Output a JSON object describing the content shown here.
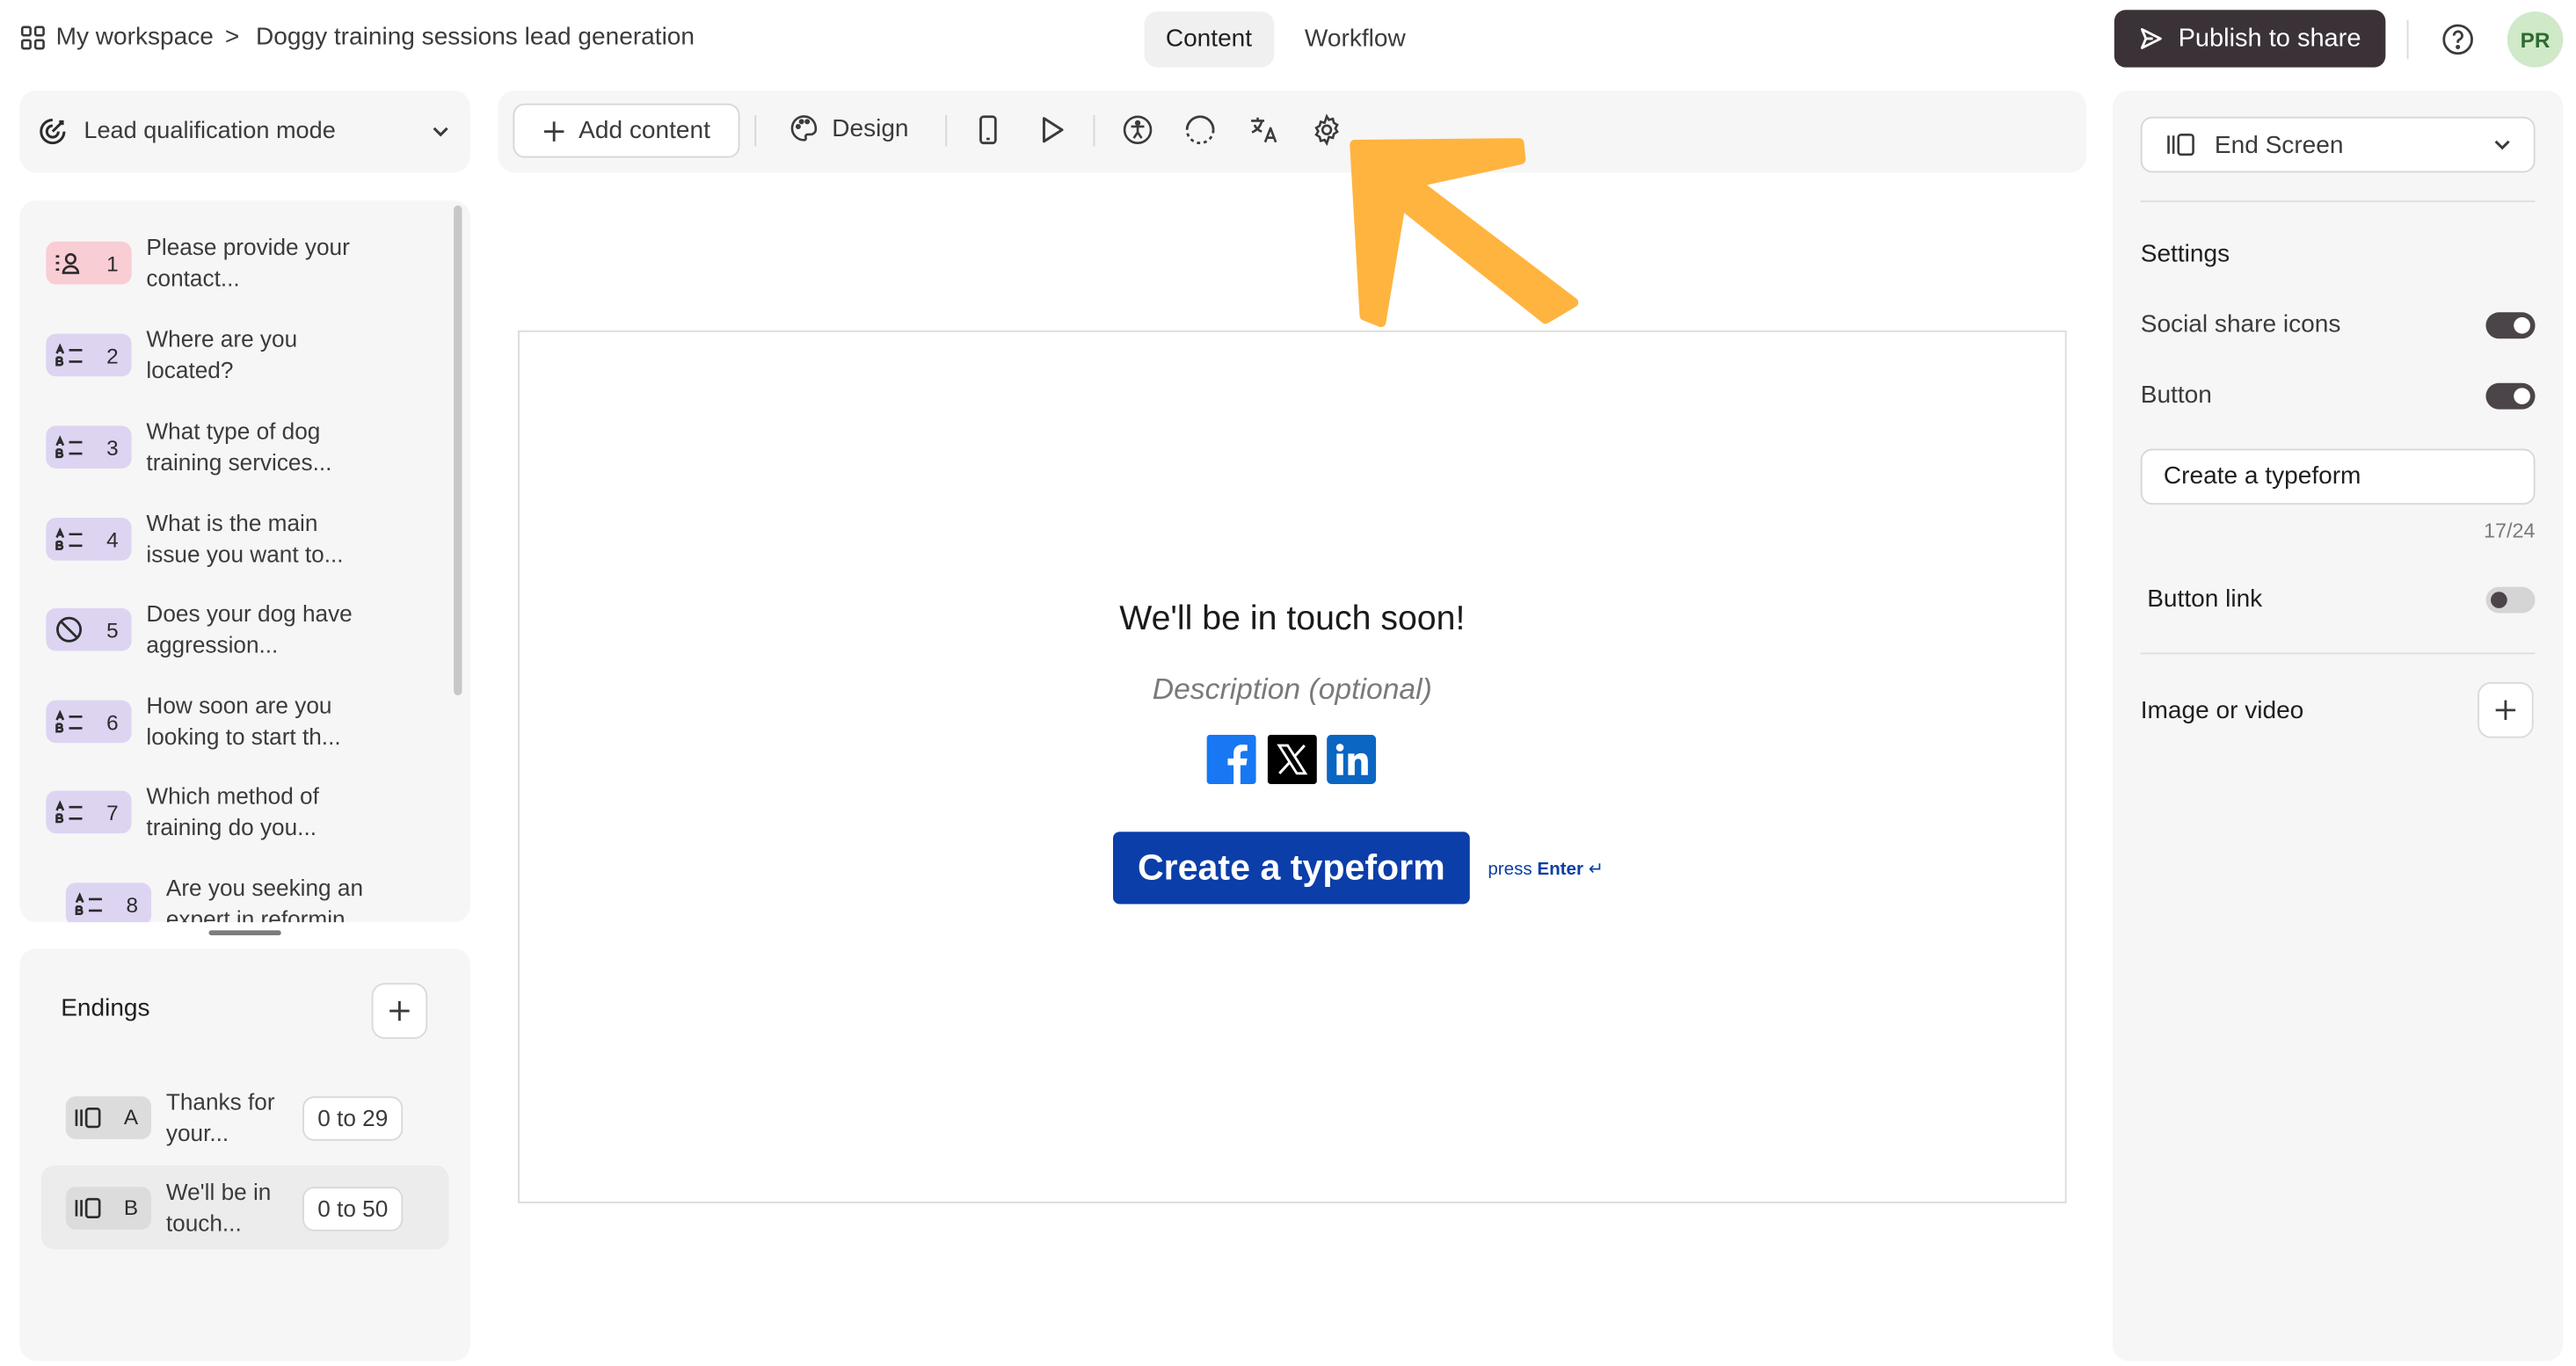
{
  "header": {
    "workspace": "My workspace",
    "separator": ">",
    "form_title": "Doggy training sessions lead generation",
    "tabs": [
      {
        "label": "Content",
        "active": true
      },
      {
        "label": "Workflow",
        "active": false
      }
    ],
    "publish_label": "Publish to share",
    "avatar_initials": "PR"
  },
  "sidebar": {
    "mode_label": "Lead qualification mode",
    "questions": [
      {
        "number": "1",
        "text": "Please provide your contact...",
        "icon": "contact-icon",
        "color": "#f8cdd3"
      },
      {
        "number": "2",
        "text": "Where are you located?",
        "icon": "multiple-choice-icon",
        "color": "#ddd4f2"
      },
      {
        "number": "3",
        "text": "What type of dog training services...",
        "icon": "multiple-choice-icon",
        "color": "#ddd4f2"
      },
      {
        "number": "4",
        "text": "What is the main issue you want to...",
        "icon": "multiple-choice-icon",
        "color": "#ddd4f2"
      },
      {
        "number": "5",
        "text": "Does your dog have aggression...",
        "icon": "yes-no-icon",
        "color": "#ddd4f2"
      },
      {
        "number": "6",
        "text": "How soon are you looking to start th...",
        "icon": "multiple-choice-icon",
        "color": "#ddd4f2"
      },
      {
        "number": "7",
        "text": "Which method of training do you...",
        "icon": "multiple-choice-icon",
        "color": "#ddd4f2"
      },
      {
        "number": "8",
        "text": "Are you seeking an expert in reformin...",
        "icon": "multiple-choice-icon",
        "color": "#ddd4f2"
      }
    ],
    "endings_title": "Endings",
    "endings": [
      {
        "letter": "A",
        "text": "Thanks for your...",
        "range": "0 to 29",
        "selected": false
      },
      {
        "letter": "B",
        "text": "We'll be in touch...",
        "range": "0 to 50",
        "selected": true
      }
    ]
  },
  "toolbar": {
    "add_content_label": "Add content",
    "design_label": "Design",
    "icons": [
      "mobile-preview-icon",
      "play-icon",
      "accessibility-icon",
      "loading-icon",
      "translate-icon",
      "settings-icon"
    ],
    "highlight_color": "#ffb43f"
  },
  "preview": {
    "title": "We'll be in touch soon!",
    "description_placeholder": "Description (optional)",
    "share_icons": [
      "facebook-icon",
      "x-icon",
      "linkedin-icon"
    ],
    "button_label": "Create a typeform",
    "press_label": "press",
    "enter_label": "Enter",
    "enter_symbol": "↵",
    "button_color": "#0b3ea8"
  },
  "right_panel": {
    "screen_select_label": "End Screen",
    "settings_title": "Settings",
    "social_share_label": "Social share icons",
    "social_share_on": true,
    "button_label": "Button",
    "button_on": true,
    "button_text_value": "Create a typeform",
    "char_counter": "17/24",
    "button_link_label": "Button link",
    "button_link_on": false,
    "media_label": "Image or video"
  }
}
